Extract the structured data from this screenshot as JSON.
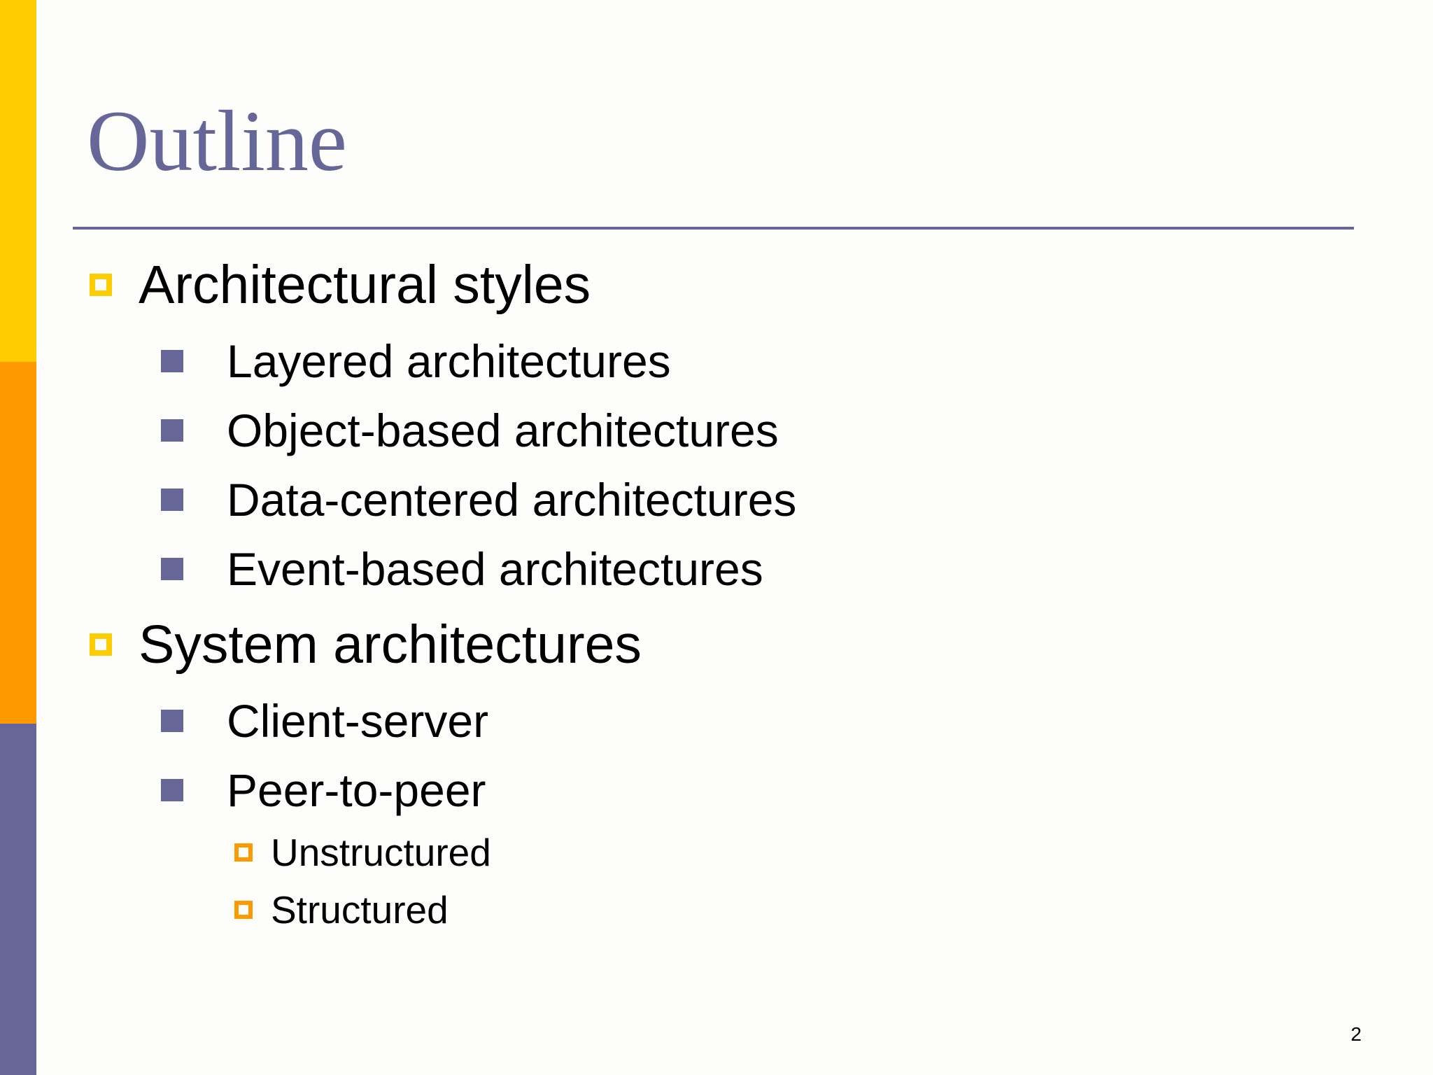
{
  "slide": {
    "title": "Outline",
    "page_number": "2",
    "colors": {
      "title": "#666699",
      "accent_yellow": "#FFCC00",
      "accent_orange": "#FF9900",
      "accent_purple": "#666699"
    },
    "bullets": [
      {
        "level": 1,
        "text": "Architectural styles",
        "icon": "hollow-square-bullet-icon"
      },
      {
        "level": 2,
        "text": "Layered architectures",
        "icon": "filled-square-bullet-icon"
      },
      {
        "level": 2,
        "text": "Object-based architectures",
        "icon": "filled-square-bullet-icon"
      },
      {
        "level": 2,
        "text": "Data-centered architectures",
        "icon": "filled-square-bullet-icon"
      },
      {
        "level": 2,
        "text": "Event-based architectures",
        "icon": "filled-square-bullet-icon"
      },
      {
        "level": 1,
        "text": "System architectures",
        "icon": "hollow-square-bullet-icon"
      },
      {
        "level": 2,
        "text": "Client-server",
        "icon": "filled-square-bullet-icon"
      },
      {
        "level": 2,
        "text": "Peer-to-peer",
        "icon": "filled-square-bullet-icon"
      },
      {
        "level": 3,
        "text": "Unstructured",
        "icon": "hollow-square-bullet-icon"
      },
      {
        "level": 3,
        "text": "Structured",
        "icon": "hollow-square-bullet-icon"
      }
    ]
  }
}
